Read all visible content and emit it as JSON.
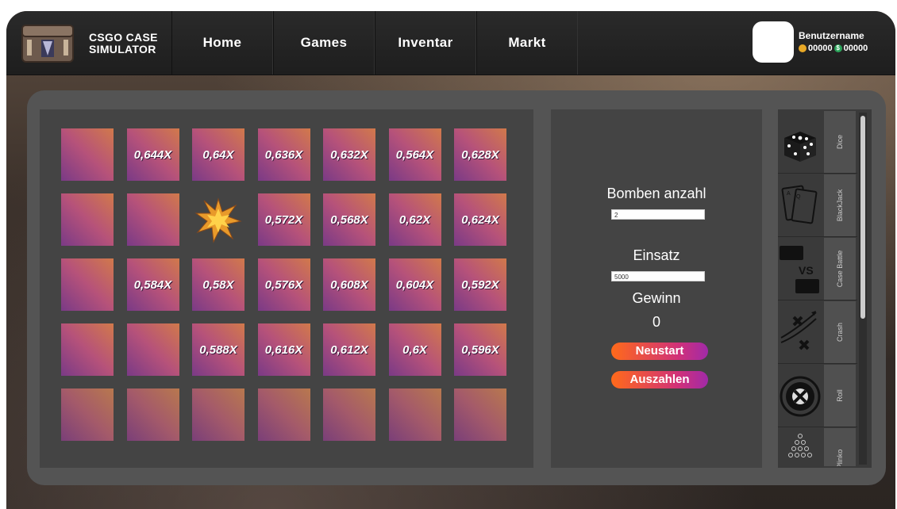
{
  "brand": {
    "line1": "CSGO CASE",
    "line2": "SIMULATOR"
  },
  "nav": [
    "Home",
    "Games",
    "Inventar",
    "Markt"
  ],
  "user": {
    "name": "Benutzername",
    "coins": "00000",
    "dollars": "00000"
  },
  "grid": {
    "rows": [
      [
        "",
        "0,644X",
        "0,64X",
        "0,636X",
        "0,632X",
        "0,564X",
        "0,628X"
      ],
      [
        "",
        "",
        "BOMB",
        "0,572X",
        "0,568X",
        "0,62X",
        "0,624X"
      ],
      [
        "",
        "0,584X",
        "0,58X",
        "0,576X",
        "0,608X",
        "0,604X",
        "0,592X"
      ],
      [
        "",
        "",
        "0,588X",
        "0,616X",
        "0,612X",
        "0,6X",
        "0,596X"
      ],
      [
        "",
        "",
        "",
        "",
        "",
        "",
        ""
      ]
    ]
  },
  "controls": {
    "bombs_label": "Bomben anzahl",
    "bombs_value": "2",
    "stake_label": "Einsatz",
    "stake_value": "5000",
    "win_label": "Gewinn",
    "win_value": "0",
    "restart_label": "Neustart",
    "cashout_label": "Auszahlen"
  },
  "games": [
    {
      "name": "Dice",
      "icon": "dice-icon"
    },
    {
      "name": "BlackJack",
      "icon": "cards-icon"
    },
    {
      "name": "Case Battle",
      "icon": "case-battle-icon"
    },
    {
      "name": "Crash",
      "icon": "crash-icon"
    },
    {
      "name": "Roll",
      "icon": "roulette-icon"
    },
    {
      "name": "Plinko",
      "icon": "plinko-icon"
    }
  ],
  "colors": {
    "accent_orange": "#ff6a1a",
    "accent_purple": "#a02aa8",
    "tile_purple": "#7a3a86",
    "tile_orange": "#d1794b"
  }
}
